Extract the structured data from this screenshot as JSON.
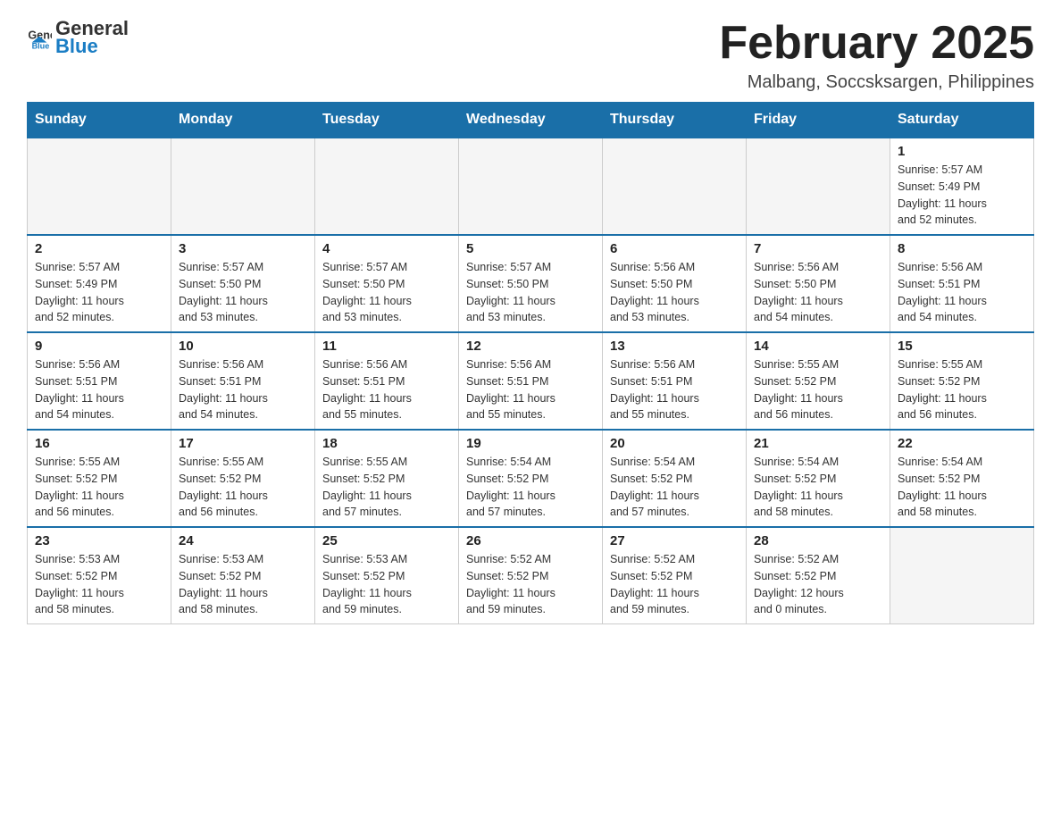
{
  "header": {
    "logo_general": "General",
    "logo_blue": "Blue",
    "month_title": "February 2025",
    "location": "Malbang, Soccsksargen, Philippines"
  },
  "days_of_week": [
    "Sunday",
    "Monday",
    "Tuesday",
    "Wednesday",
    "Thursday",
    "Friday",
    "Saturday"
  ],
  "weeks": [
    {
      "days": [
        {
          "num": "",
          "info": ""
        },
        {
          "num": "",
          "info": ""
        },
        {
          "num": "",
          "info": ""
        },
        {
          "num": "",
          "info": ""
        },
        {
          "num": "",
          "info": ""
        },
        {
          "num": "",
          "info": ""
        },
        {
          "num": "1",
          "info": "Sunrise: 5:57 AM\nSunset: 5:49 PM\nDaylight: 11 hours\nand 52 minutes."
        }
      ]
    },
    {
      "days": [
        {
          "num": "2",
          "info": "Sunrise: 5:57 AM\nSunset: 5:49 PM\nDaylight: 11 hours\nand 52 minutes."
        },
        {
          "num": "3",
          "info": "Sunrise: 5:57 AM\nSunset: 5:50 PM\nDaylight: 11 hours\nand 53 minutes."
        },
        {
          "num": "4",
          "info": "Sunrise: 5:57 AM\nSunset: 5:50 PM\nDaylight: 11 hours\nand 53 minutes."
        },
        {
          "num": "5",
          "info": "Sunrise: 5:57 AM\nSunset: 5:50 PM\nDaylight: 11 hours\nand 53 minutes."
        },
        {
          "num": "6",
          "info": "Sunrise: 5:56 AM\nSunset: 5:50 PM\nDaylight: 11 hours\nand 53 minutes."
        },
        {
          "num": "7",
          "info": "Sunrise: 5:56 AM\nSunset: 5:50 PM\nDaylight: 11 hours\nand 54 minutes."
        },
        {
          "num": "8",
          "info": "Sunrise: 5:56 AM\nSunset: 5:51 PM\nDaylight: 11 hours\nand 54 minutes."
        }
      ]
    },
    {
      "days": [
        {
          "num": "9",
          "info": "Sunrise: 5:56 AM\nSunset: 5:51 PM\nDaylight: 11 hours\nand 54 minutes."
        },
        {
          "num": "10",
          "info": "Sunrise: 5:56 AM\nSunset: 5:51 PM\nDaylight: 11 hours\nand 54 minutes."
        },
        {
          "num": "11",
          "info": "Sunrise: 5:56 AM\nSunset: 5:51 PM\nDaylight: 11 hours\nand 55 minutes."
        },
        {
          "num": "12",
          "info": "Sunrise: 5:56 AM\nSunset: 5:51 PM\nDaylight: 11 hours\nand 55 minutes."
        },
        {
          "num": "13",
          "info": "Sunrise: 5:56 AM\nSunset: 5:51 PM\nDaylight: 11 hours\nand 55 minutes."
        },
        {
          "num": "14",
          "info": "Sunrise: 5:55 AM\nSunset: 5:52 PM\nDaylight: 11 hours\nand 56 minutes."
        },
        {
          "num": "15",
          "info": "Sunrise: 5:55 AM\nSunset: 5:52 PM\nDaylight: 11 hours\nand 56 minutes."
        }
      ]
    },
    {
      "days": [
        {
          "num": "16",
          "info": "Sunrise: 5:55 AM\nSunset: 5:52 PM\nDaylight: 11 hours\nand 56 minutes."
        },
        {
          "num": "17",
          "info": "Sunrise: 5:55 AM\nSunset: 5:52 PM\nDaylight: 11 hours\nand 56 minutes."
        },
        {
          "num": "18",
          "info": "Sunrise: 5:55 AM\nSunset: 5:52 PM\nDaylight: 11 hours\nand 57 minutes."
        },
        {
          "num": "19",
          "info": "Sunrise: 5:54 AM\nSunset: 5:52 PM\nDaylight: 11 hours\nand 57 minutes."
        },
        {
          "num": "20",
          "info": "Sunrise: 5:54 AM\nSunset: 5:52 PM\nDaylight: 11 hours\nand 57 minutes."
        },
        {
          "num": "21",
          "info": "Sunrise: 5:54 AM\nSunset: 5:52 PM\nDaylight: 11 hours\nand 58 minutes."
        },
        {
          "num": "22",
          "info": "Sunrise: 5:54 AM\nSunset: 5:52 PM\nDaylight: 11 hours\nand 58 minutes."
        }
      ]
    },
    {
      "days": [
        {
          "num": "23",
          "info": "Sunrise: 5:53 AM\nSunset: 5:52 PM\nDaylight: 11 hours\nand 58 minutes."
        },
        {
          "num": "24",
          "info": "Sunrise: 5:53 AM\nSunset: 5:52 PM\nDaylight: 11 hours\nand 58 minutes."
        },
        {
          "num": "25",
          "info": "Sunrise: 5:53 AM\nSunset: 5:52 PM\nDaylight: 11 hours\nand 59 minutes."
        },
        {
          "num": "26",
          "info": "Sunrise: 5:52 AM\nSunset: 5:52 PM\nDaylight: 11 hours\nand 59 minutes."
        },
        {
          "num": "27",
          "info": "Sunrise: 5:52 AM\nSunset: 5:52 PM\nDaylight: 11 hours\nand 59 minutes."
        },
        {
          "num": "28",
          "info": "Sunrise: 5:52 AM\nSunset: 5:52 PM\nDaylight: 12 hours\nand 0 minutes."
        },
        {
          "num": "",
          "info": ""
        }
      ]
    }
  ]
}
